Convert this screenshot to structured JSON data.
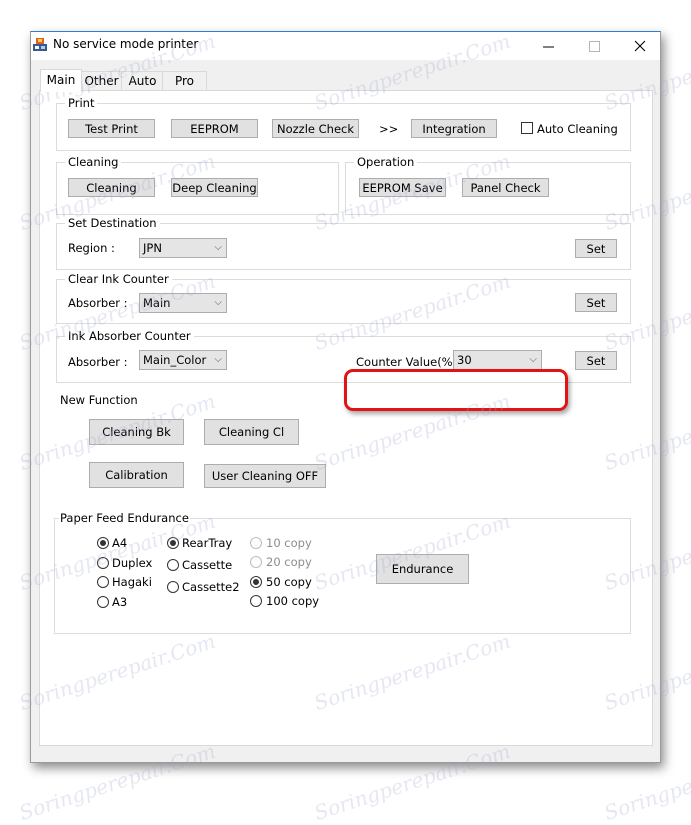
{
  "window": {
    "title": "No service mode printer",
    "minimize_label": "—",
    "maximize_label": "☐",
    "close_label": "✕"
  },
  "tabs": [
    {
      "label": "Main",
      "active": true
    },
    {
      "label": "Other",
      "active": false
    },
    {
      "label": "Auto",
      "active": false
    },
    {
      "label": "Pro",
      "active": false
    }
  ],
  "print_group": {
    "label": "Print",
    "test_print": "Test Print",
    "eeprom": "EEPROM",
    "nozzle_check": "Nozzle Check",
    "arrow": ">>",
    "integration": "Integration",
    "auto_cleaning_label": "Auto Cleaning",
    "auto_cleaning_checked": false
  },
  "cleaning_group": {
    "label": "Cleaning",
    "cleaning": "Cleaning",
    "deep_cleaning": "Deep Cleaning"
  },
  "operation_group": {
    "label": "Operation",
    "eeprom_save": "EEPROM Save",
    "panel_check": "Panel Check"
  },
  "set_destination": {
    "label": "Set Destination",
    "region_label": "Region :",
    "region_value": "JPN",
    "set": "Set"
  },
  "clear_ink_counter": {
    "label": "Clear Ink Counter",
    "absorber_label": "Absorber :",
    "absorber_value": "Main",
    "set": "Set"
  },
  "ink_absorber_counter": {
    "label": "Ink Absorber Counter",
    "absorber_label": "Absorber :",
    "absorber_value": "Main_Color",
    "counter_label": "Counter Value(%) :",
    "counter_value": "30",
    "set": "Set"
  },
  "new_function": {
    "label": "New Function",
    "cleaning_bk": "Cleaning Bk",
    "cleaning_cl": "Cleaning Cl",
    "calibration": "Calibration",
    "user_cleaning_off": "User Cleaning OFF"
  },
  "paper_feed": {
    "label": "Paper Feed Endurance",
    "paper_sizes": [
      {
        "label": "A4",
        "checked": true
      },
      {
        "label": "Duplex",
        "checked": false
      },
      {
        "label": "Hagaki",
        "checked": false
      },
      {
        "label": "A3",
        "checked": false
      }
    ],
    "sources": [
      {
        "label": "RearTray",
        "checked": true
      },
      {
        "label": "Cassette",
        "checked": false
      },
      {
        "label": "Cassette2",
        "checked": false
      }
    ],
    "copies": [
      {
        "label": "10 copy",
        "checked": false,
        "disabled": true
      },
      {
        "label": "20 copy",
        "checked": false,
        "disabled": true
      },
      {
        "label": "50 copy",
        "checked": true,
        "disabled": false
      },
      {
        "label": "100 copy",
        "checked": false,
        "disabled": false
      }
    ],
    "endurance": "Endurance"
  },
  "watermark_text": "Soringperepair.Com"
}
